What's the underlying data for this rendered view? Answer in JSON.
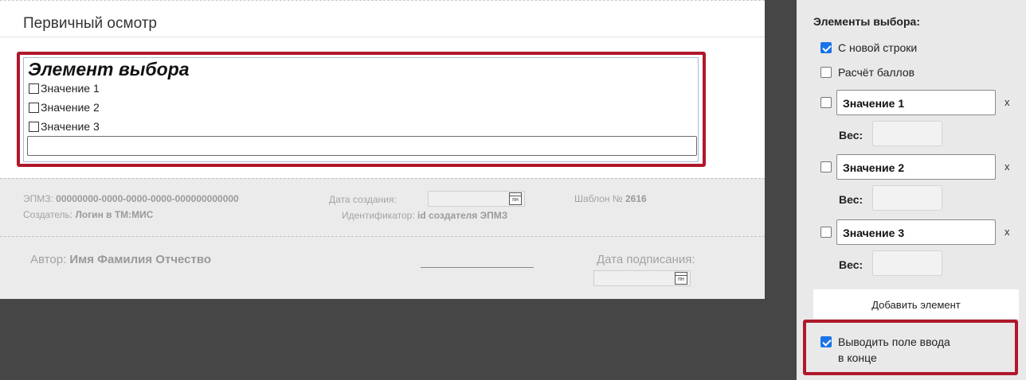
{
  "document": {
    "title": "Первичный осмотр",
    "choice_element": {
      "title": "Элемент выбора",
      "options": [
        "Значение 1",
        "Значение 2",
        "Значение 3"
      ],
      "free_input_value": ""
    },
    "meta": {
      "epmz_label": "ЭПМЗ:",
      "epmz_value": "00000000-0000-0000-0000-000000000000",
      "creator_label": "Создатель:",
      "creator_value": "Логин в ТМ:МИС",
      "created_date_label": "Дата создания:",
      "calendar_glyph": "пн",
      "identifier_label": "Идентификатор:",
      "identifier_value": "id создателя ЭПМЗ",
      "template_label": "Шаблон №",
      "template_value": "2616"
    },
    "signature": {
      "author_label": "Автор:",
      "author_value": "Имя Фамилия Отчество",
      "sign_date_label": "Дата подписания:"
    }
  },
  "panel": {
    "heading": "Элементы выбора:",
    "new_line_label": "С новой строки",
    "new_line_checked": true,
    "score_label": "Расчёт баллов",
    "score_checked": false,
    "values": [
      {
        "label": "Значение 1",
        "checked": false,
        "weight": ""
      },
      {
        "label": "Значение 2",
        "checked": false,
        "weight": ""
      },
      {
        "label": "Значение 3",
        "checked": false,
        "weight": ""
      }
    ],
    "weight_label": "Вес:",
    "delete_glyph": "x",
    "add_button_label": "Добавить элемент",
    "output_field_label_line1": "Выводить поле ввода",
    "output_field_label_line2": "в конце",
    "output_field_checked": true
  }
}
